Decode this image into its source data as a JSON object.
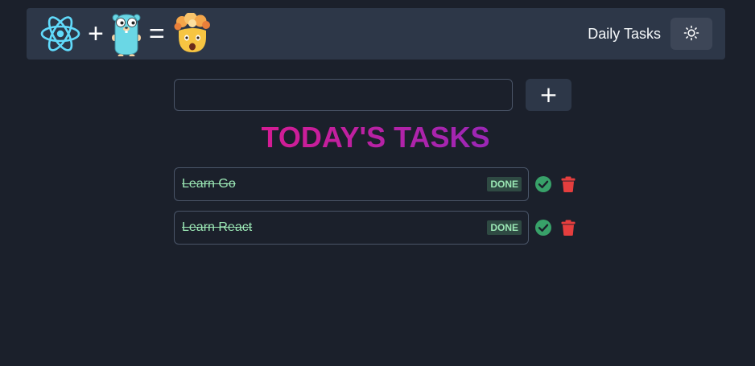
{
  "navbar": {
    "logo": {
      "left_icon": "react-logo-icon",
      "plus": "+",
      "middle_icon": "gopher-icon",
      "equals": "=",
      "right_icon": "exploding-head-emoji-icon"
    },
    "title": "Daily Tasks",
    "theme_toggle_icon": "sun-icon"
  },
  "add_task": {
    "input_value": "",
    "input_placeholder": "",
    "button_label": "+"
  },
  "heading": "TODAY'S TASKS",
  "tasks": [
    {
      "text": "Learn Go",
      "status": "DONE",
      "complete_icon": "check-circle-icon",
      "delete_icon": "trash-icon"
    },
    {
      "text": "Learn React",
      "status": "DONE",
      "complete_icon": "check-circle-icon",
      "delete_icon": "trash-icon"
    }
  ],
  "colors": {
    "background": "#1b202b",
    "navbar": "#2d3748",
    "heading_gradient_start": "#d51c93",
    "heading_gradient_end": "#9b27b6",
    "done_text": "#9ae6b4",
    "check_icon": "#38a169",
    "delete_icon": "#e53e3e"
  }
}
